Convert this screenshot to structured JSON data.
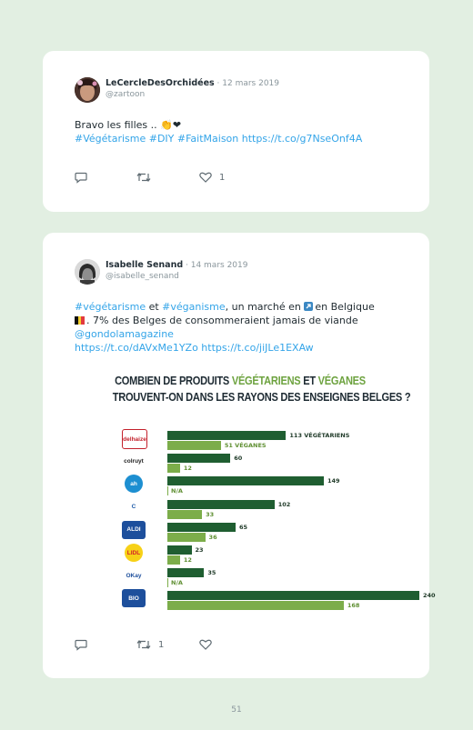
{
  "tweet1": {
    "author": "LeCercleDesOrchidées",
    "date": " · 12 mars 2019",
    "handle": "@zartoon",
    "text_prefix": "Bravo les filles .. ",
    "emoji": "👏❤",
    "hashtags": "#Végétarisme #DIY #FaitMaison",
    "link": "https://t.co/g7NseOnf4A",
    "likes": "1"
  },
  "tweet2": {
    "author": "Isabelle Senand",
    "date": " · 14 mars 2019",
    "handle": "@isabelle_senand",
    "hashtag1": "#végétarisme",
    "and": " et ",
    "hashtag2": "#véganisme",
    "text_mid": ", un marché en ",
    "text_mid2": "en Belgique",
    "text_rest": ". 7% des Belges de consommeraient jamais de viande",
    "mention": "@gondolamagazine",
    "links": "https://t.co/dAVxMe1YZo https://t.co/jiJLe1EXAw",
    "retweets": "1"
  },
  "chart_data": {
    "type": "bar",
    "title_line1_a": "COMBIEN DE PRODUITS ",
    "title_line1_b": "VÉGÉTARIENS",
    "title_line1_c": " ET ",
    "title_line1_d": "VÉGANES",
    "title_line2": "TROUVENT-ON DANS LES RAYONS DES ENSEIGNES BELGES ?",
    "categories": [
      "Delhaize",
      "colruyt",
      "Albert Heijn",
      "Carrefour",
      "Aldi",
      "Lidl",
      "OKay",
      "Bio-Planet"
    ],
    "logo_labels": [
      "delhaize",
      "colruyt",
      "ah",
      "C",
      "ALDI",
      "LIDL",
      "OKay",
      "BIO"
    ],
    "series": [
      {
        "name": "VÉGÉTARIENS",
        "values": [
          113,
          60,
          149,
          102,
          65,
          23,
          35,
          240
        ],
        "color": "#1f5e31"
      },
      {
        "name": "VÉGANES",
        "values": [
          51,
          12,
          null,
          33,
          36,
          12,
          null,
          168
        ],
        "color": "#7cad4a"
      }
    ],
    "labels_dark": [
      "113 VÉGÉTARIENS",
      "60",
      "149",
      "102",
      "65",
      "23",
      "35",
      "240"
    ],
    "labels_light": [
      "51 VÉGANES",
      "12",
      "N/A",
      "33",
      "36",
      "12",
      "N/A",
      "168"
    ],
    "xlim": [
      0,
      240
    ]
  },
  "page_number": "51"
}
